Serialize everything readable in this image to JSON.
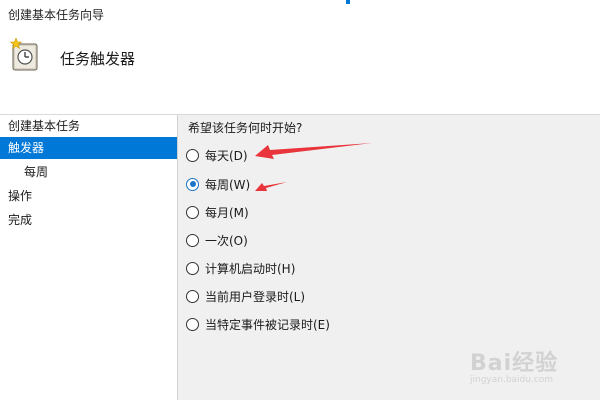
{
  "window": {
    "title": "创建基本任务向导",
    "accent_color": "#0078d7"
  },
  "header": {
    "title": "任务触发器",
    "icon": "task-scheduler-clock-icon"
  },
  "sidebar": {
    "items": [
      {
        "label": "创建基本任务",
        "active": false,
        "level": 0
      },
      {
        "label": "触发器",
        "active": true,
        "level": 0
      },
      {
        "label": "每周",
        "active": false,
        "level": 1
      },
      {
        "label": "操作",
        "active": false,
        "level": 0
      },
      {
        "label": "完成",
        "active": false,
        "level": 0
      }
    ]
  },
  "content": {
    "prompt": "希望该任务何时开始?",
    "options": [
      {
        "label": "每天(D)",
        "checked": false
      },
      {
        "label": "每周(W)",
        "checked": true
      },
      {
        "label": "每月(M)",
        "checked": false
      },
      {
        "label": "一次(O)",
        "checked": false
      },
      {
        "label": "计算机启动时(H)",
        "checked": false
      },
      {
        "label": "当前用户登录时(L)",
        "checked": false
      },
      {
        "label": "当特定事件被记录时(E)",
        "checked": false
      }
    ]
  },
  "annotations": {
    "arrow_color": "#e8343a"
  },
  "watermark": {
    "text": "Bai经验",
    "url": "jingyan.baidu.com"
  }
}
